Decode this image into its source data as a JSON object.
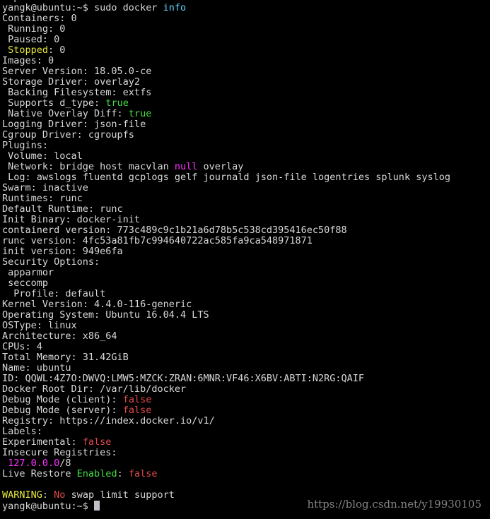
{
  "colors": {
    "default": "#d8d8d8",
    "green": "#44dd44",
    "red": "#e04a4a",
    "yellow": "#e6e63a",
    "magenta": "#ff30ff",
    "cyan": "#5cd6ff"
  },
  "lines": [
    [
      [
        "Experimental: ",
        "default"
      ],
      [
        "false",
        "red"
      ]
    ],
    [
      [
        "yangk@ubuntu:~$ sudo docker ",
        "default"
      ],
      [
        "info",
        "cyan"
      ]
    ],
    [
      [
        "Containers: 0",
        "default"
      ]
    ],
    [
      [
        " Running: 0",
        "default"
      ]
    ],
    [
      [
        " Paused: 0",
        "default"
      ]
    ],
    [
      [
        " ",
        "default"
      ],
      [
        "Stopped",
        "yellow"
      ],
      [
        ": 0",
        "default"
      ]
    ],
    [
      [
        "Images: 0",
        "default"
      ]
    ],
    [
      [
        "Server Version: 18.05.0-ce",
        "default"
      ]
    ],
    [
      [
        "Storage Driver: overlay2",
        "default"
      ]
    ],
    [
      [
        " Backing Filesystem: extfs",
        "default"
      ]
    ],
    [
      [
        " Supports d_type: ",
        "default"
      ],
      [
        "true",
        "green"
      ]
    ],
    [
      [
        " Native Overlay Diff: ",
        "default"
      ],
      [
        "true",
        "green"
      ]
    ],
    [
      [
        "Logging Driver: json-file",
        "default"
      ]
    ],
    [
      [
        "Cgroup Driver: cgroupfs",
        "default"
      ]
    ],
    [
      [
        "Plugins:",
        "default"
      ]
    ],
    [
      [
        " Volume: local",
        "default"
      ]
    ],
    [
      [
        " Network: bridge host macvlan ",
        "default"
      ],
      [
        "null",
        "magenta"
      ],
      [
        " overlay",
        "default"
      ]
    ],
    [
      [
        " Log: awslogs fluentd gcplogs gelf journald json-file logentries splunk syslog",
        "default"
      ]
    ],
    [
      [
        "Swarm: inactive",
        "default"
      ]
    ],
    [
      [
        "Runtimes: runc",
        "default"
      ]
    ],
    [
      [
        "Default Runtime: runc",
        "default"
      ]
    ],
    [
      [
        "Init Binary: docker-init",
        "default"
      ]
    ],
    [
      [
        "containerd version: 773c489c9c1b21a6d78b5c538cd395416ec50f88",
        "default"
      ]
    ],
    [
      [
        "runc version: 4fc53a81fb7c994640722ac585fa9ca548971871",
        "default"
      ]
    ],
    [
      [
        "init version: 949e6fa",
        "default"
      ]
    ],
    [
      [
        "Security Options:",
        "default"
      ]
    ],
    [
      [
        " apparmor",
        "default"
      ]
    ],
    [
      [
        " seccomp",
        "default"
      ]
    ],
    [
      [
        "  Profile: default",
        "default"
      ]
    ],
    [
      [
        "Kernel Version: 4.4.0-116-generic",
        "default"
      ]
    ],
    [
      [
        "Operating System: Ubuntu 16.04.4 LTS",
        "default"
      ]
    ],
    [
      [
        "OSType: linux",
        "default"
      ]
    ],
    [
      [
        "Architecture: x86_64",
        "default"
      ]
    ],
    [
      [
        "CPUs: 4",
        "default"
      ]
    ],
    [
      [
        "Total Memory: 31.42GiB",
        "default"
      ]
    ],
    [
      [
        "Name: ubuntu",
        "default"
      ]
    ],
    [
      [
        "ID: QQWL:4Z7O:DWVQ:LMW5:MZCK:ZRAN:6MNR:VF46:X6BV:ABTI:N2RG:QAIF",
        "default"
      ]
    ],
    [
      [
        "Docker Root Dir: /var/lib/docker",
        "default"
      ]
    ],
    [
      [
        "Debug Mode (client): ",
        "default"
      ],
      [
        "false",
        "red"
      ]
    ],
    [
      [
        "Debug Mode (server): ",
        "default"
      ],
      [
        "false",
        "red"
      ]
    ],
    [
      [
        "Registry: https://index.docker.io/v1/",
        "default"
      ]
    ],
    [
      [
        "Labels:",
        "default"
      ]
    ],
    [
      [
        "Experimental: ",
        "default"
      ],
      [
        "false",
        "red"
      ]
    ],
    [
      [
        "Insecure Registries:",
        "default"
      ]
    ],
    [
      [
        " ",
        "default"
      ],
      [
        "127.0.0.0",
        "magenta"
      ],
      [
        "/8",
        "default"
      ]
    ],
    [
      [
        "Live Restore ",
        "default"
      ],
      [
        "Enabled",
        "green"
      ],
      [
        ": ",
        "default"
      ],
      [
        "false",
        "red"
      ]
    ],
    [
      [
        "",
        "default"
      ]
    ],
    [
      [
        "WARNING",
        "yellow"
      ],
      [
        ": ",
        "default"
      ],
      [
        "No",
        "red"
      ],
      [
        " swap limit support",
        "default"
      ]
    ],
    [
      [
        "yangk@ubuntu:~$ ",
        "default"
      ]
    ]
  ],
  "watermark": "https://blog.csdn.net/y19930105"
}
